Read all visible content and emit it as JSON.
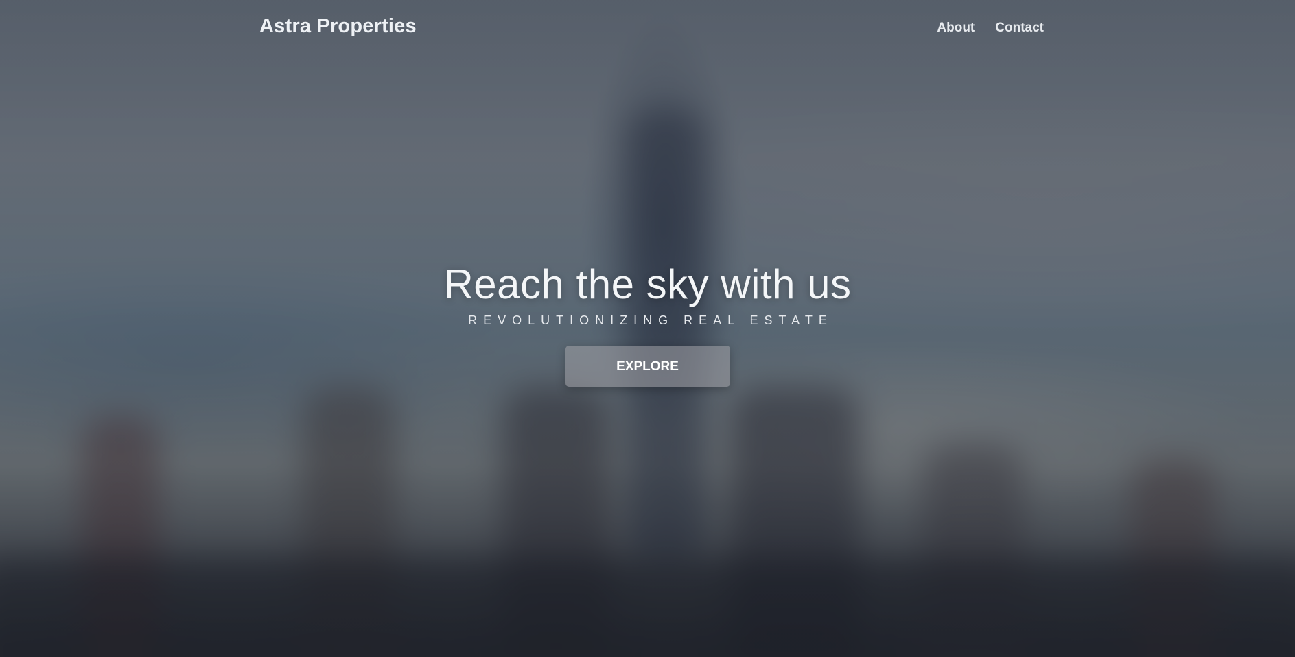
{
  "header": {
    "brand": "Astra Properties",
    "nav": [
      {
        "label": "About"
      },
      {
        "label": "Contact"
      }
    ]
  },
  "hero": {
    "title": "Reach the sky with us",
    "subtitle": "REVOLUTIONIZING REAL ESTATE",
    "cta_label": "EXPLORE"
  },
  "colors": {
    "text": "#ffffff",
    "button_bg": "#9a9aa0"
  }
}
